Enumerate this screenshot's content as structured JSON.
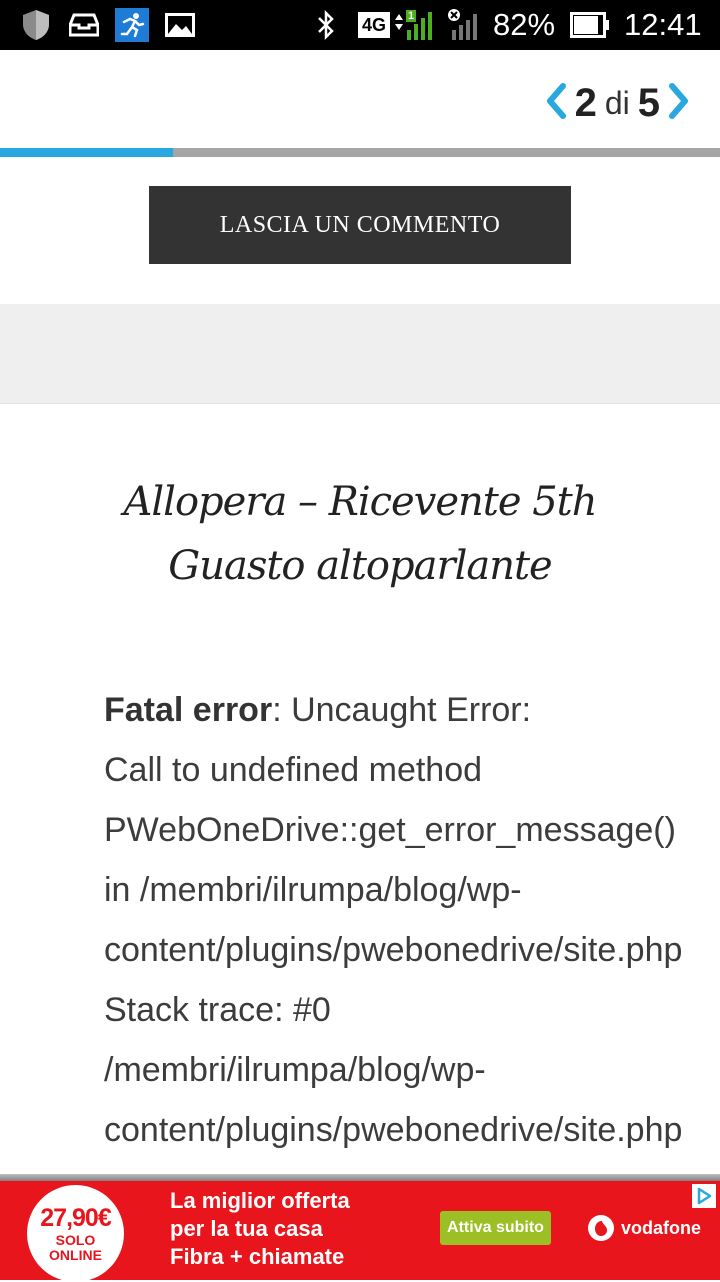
{
  "status_bar": {
    "battery_percent": "82%",
    "time": "12:41",
    "network_type": "4G",
    "sim_slot": "1",
    "icons": [
      "shield-icon",
      "inbox-tray-icon",
      "running-man-icon",
      "image-icon",
      "bluetooth-icon",
      "signal-icon",
      "no-signal-icon",
      "battery-icon"
    ]
  },
  "pager": {
    "current": "2",
    "separator": "di",
    "total": "5",
    "progress_fraction": 0.24,
    "accent_color": "#29a8e0"
  },
  "comment_button": {
    "label": "LASCIA UN COMMENTO"
  },
  "post_title": {
    "line1": "Allopera – Ricevente 5th",
    "line2": "Guasto altoparlante"
  },
  "error": {
    "label": "Fatal error",
    "lines": [
      ": Uncaught Error:",
      "Call to undefined method",
      "PWebOneDrive::get_error_message()",
      "in /membri/ilrumpa/blog/wp-",
      "content/plugins/pwebonedrive/site.php",
      "Stack trace: #0",
      "/membri/ilrumpa/blog/wp-",
      "content/plugins/pwebonedrive/site.php"
    ]
  },
  "ad": {
    "price": "27,90€",
    "price_line1": "SOLO",
    "price_line2": "ONLINE",
    "headline1": "La miglior offerta",
    "headline2": "per la tua casa",
    "headline3": "Fibra + chiamate",
    "cta": "Attiva subito",
    "brand": "vodafone",
    "background_color": "#e8151c",
    "cta_color": "#9bbf25"
  }
}
